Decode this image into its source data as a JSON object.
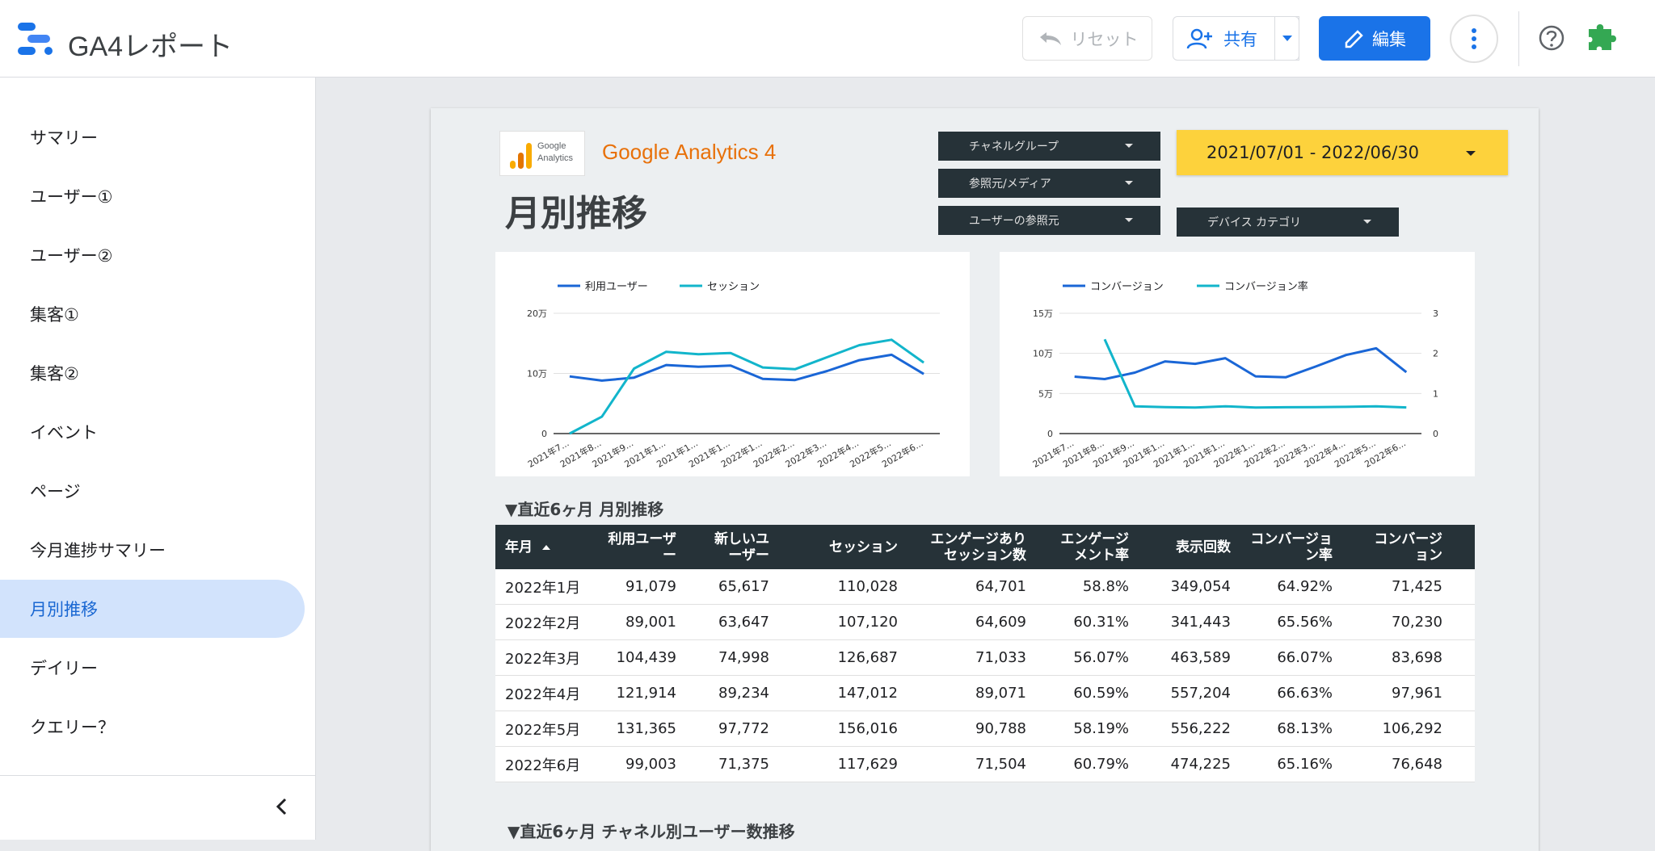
{
  "header": {
    "app_title": "GA4レポート",
    "reset_label": "リセット",
    "share_label": "共有",
    "edit_label": "編集"
  },
  "sidebar": {
    "items": [
      {
        "label": "サマリー",
        "active": false
      },
      {
        "label": "ユーザー①",
        "active": false
      },
      {
        "label": "ユーザー②",
        "active": false
      },
      {
        "label": "集客①",
        "active": false
      },
      {
        "label": "集客②",
        "active": false
      },
      {
        "label": "イベント",
        "active": false
      },
      {
        "label": "ページ",
        "active": false
      },
      {
        "label": "今月進捗サマリー",
        "active": false
      },
      {
        "label": "月別推移",
        "active": true
      },
      {
        "label": "デイリー",
        "active": false
      },
      {
        "label": "クエリー？",
        "active": false
      }
    ]
  },
  "report": {
    "ga_logo_line1": "Google",
    "ga_logo_line2": "Analytics",
    "brand": "Google Analytics 4",
    "page_title": "月別推移",
    "filters": {
      "channel": "チャネルグループ",
      "source": "参照元/メディア",
      "user_source": "ユーザーの参照元",
      "device": "デバイス カテゴリ"
    },
    "date_range": "2021/07/01 - 2022/06/30",
    "section1": "▼直近6ヶ月 月別推移",
    "section2": "▼直近6ヶ月 チャネル別ユーザー数推移"
  },
  "colors": {
    "series_primary": "#1a66d6",
    "series_secondary": "#12b5cb",
    "table_header": "#263238",
    "date_range_bg": "#fdd23c",
    "brand_orange": "#e8710a"
  },
  "chart_data": [
    {
      "type": "line",
      "x": [
        "2021年7...",
        "2021年8...",
        "2021年9...",
        "2021年1...",
        "2021年1...",
        "2021年1...",
        "2022年1...",
        "2022年2...",
        "2022年3...",
        "2022年4...",
        "2022年5...",
        "2022年6..."
      ],
      "series": [
        {
          "name": "利用ユーザー",
          "values": [
            95000,
            88000,
            93000,
            114000,
            111000,
            113000,
            91000,
            89000,
            104000,
            122000,
            131000,
            99000
          ]
        },
        {
          "name": "セッション",
          "values": [
            0,
            28000,
            108000,
            136000,
            132000,
            134000,
            110000,
            107000,
            127000,
            147000,
            156000,
            118000
          ]
        }
      ],
      "yticks": [
        "0",
        "10万",
        "20万"
      ],
      "ylim": [
        0,
        200000
      ]
    },
    {
      "type": "line",
      "x": [
        "2021年7...",
        "2021年8...",
        "2021年9...",
        "2021年1...",
        "2021年1...",
        "2021年1...",
        "2022年1...",
        "2022年2...",
        "2022年3...",
        "2022年4...",
        "2022年5...",
        "2022年6..."
      ],
      "series": [
        {
          "name": "コンバージョン",
          "axis": "left",
          "values": [
            71000,
            68000,
            76000,
            90000,
            87000,
            94000,
            71400,
            70200,
            83700,
            98000,
            106300,
            76600
          ]
        },
        {
          "name": "コンバージョン率",
          "axis": "right",
          "values": [
            null,
            2.35,
            0.68,
            0.66,
            0.65,
            0.68,
            0.65,
            0.656,
            0.661,
            0.666,
            0.681,
            0.652
          ]
        }
      ],
      "yticks_left": [
        "0",
        "5万",
        "10万",
        "15万"
      ],
      "ylim_left": [
        0,
        150000
      ],
      "yticks_right": [
        "0",
        "1",
        "2",
        "3"
      ],
      "ylim_right": [
        0,
        3
      ]
    }
  ],
  "table": {
    "headers": [
      [
        "年月"
      ],
      [
        "利用ユーザ",
        "ー"
      ],
      [
        "新しいユ",
        "ーザー"
      ],
      [
        "セッション"
      ],
      [
        "エンゲージあり",
        "セッション数"
      ],
      [
        "エンゲージ",
        "メント率"
      ],
      [
        "表示回数"
      ],
      [
        "コンバージョ",
        "ン率"
      ],
      [
        "コンバージ",
        "ョン"
      ]
    ],
    "rows": [
      [
        "2022年1月",
        "91,079",
        "65,617",
        "110,028",
        "64,701",
        "58.8%",
        "349,054",
        "64.92%",
        "71,425"
      ],
      [
        "2022年2月",
        "89,001",
        "63,647",
        "107,120",
        "64,609",
        "60.31%",
        "341,443",
        "65.56%",
        "70,230"
      ],
      [
        "2022年3月",
        "104,439",
        "74,998",
        "126,687",
        "71,033",
        "56.07%",
        "463,589",
        "66.07%",
        "83,698"
      ],
      [
        "2022年4月",
        "121,914",
        "89,234",
        "147,012",
        "89,071",
        "60.59%",
        "557,204",
        "66.63%",
        "97,961"
      ],
      [
        "2022年5月",
        "131,365",
        "97,772",
        "156,016",
        "90,788",
        "58.19%",
        "556,222",
        "68.13%",
        "106,292"
      ],
      [
        "2022年6月",
        "99,003",
        "71,375",
        "117,629",
        "71,504",
        "60.79%",
        "474,225",
        "65.16%",
        "76,648"
      ]
    ]
  }
}
